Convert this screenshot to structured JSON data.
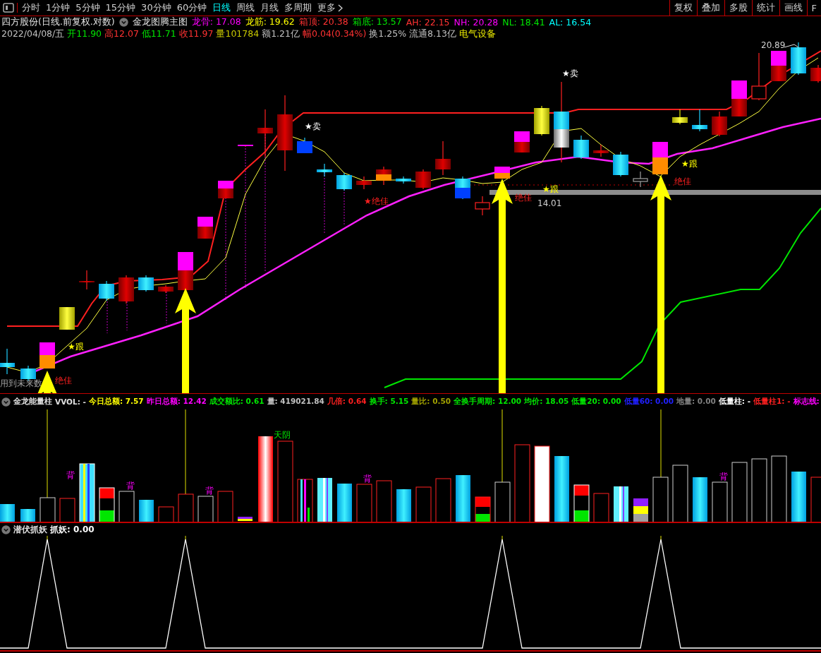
{
  "toolbar": {
    "periods": [
      {
        "label": "分时",
        "selected": false
      },
      {
        "label": "1分钟",
        "selected": false
      },
      {
        "label": "5分钟",
        "selected": false
      },
      {
        "label": "15分钟",
        "selected": false
      },
      {
        "label": "30分钟",
        "selected": false
      },
      {
        "label": "60分钟",
        "selected": false
      },
      {
        "label": "日线",
        "selected": true
      },
      {
        "label": "周线",
        "selected": false
      },
      {
        "label": "月线",
        "selected": false
      },
      {
        "label": "多周期",
        "selected": false
      }
    ],
    "more": "更多",
    "buttons": [
      "复权",
      "叠加",
      "多股",
      "统计",
      "画线",
      "F"
    ]
  },
  "main_header": {
    "title": "四方股份(日线.前复权.对数)",
    "indicator": "金龙图腾主图",
    "values": [
      {
        "text": "龙骨: 17.08",
        "color": "#ff00ff"
      },
      {
        "text": "龙筋: 19.62",
        "color": "#ffff00"
      },
      {
        "text": "箱顶: 20.38",
        "color": "#ff3232"
      },
      {
        "text": "箱底: 13.57",
        "color": "#00e600"
      },
      {
        "text": "AH: 22.15",
        "color": "#ff3232"
      },
      {
        "text": "NH: 20.28",
        "color": "#ff00ff"
      },
      {
        "text": "NL: 18.41",
        "color": "#00e600"
      },
      {
        "text": "AL: 16.54",
        "color": "#00ffff"
      }
    ]
  },
  "quote": {
    "date": "2022/04/08/五",
    "items": [
      {
        "text": "开11.90",
        "color": "#00e600"
      },
      {
        "text": "高12.07",
        "color": "#ff3232"
      },
      {
        "text": "低11.71",
        "color": "#00e600"
      },
      {
        "text": "收11.97",
        "color": "#ff3232"
      },
      {
        "text": "量101784",
        "color": "#c8c800"
      },
      {
        "text": "额1.21亿",
        "color": "#c0c0c0"
      },
      {
        "text": "幅0.04(0.34%)",
        "color": "#ff3232"
      },
      {
        "text": "换1.25%",
        "color": "#c0c0c0"
      },
      {
        "text": "流通8.13亿",
        "color": "#c0c0c0"
      },
      {
        "text": "电气设备",
        "color": "#e6e600"
      }
    ]
  },
  "main_labels": [
    {
      "text": "★卖",
      "kind": "sell"
    },
    {
      "text": "★卖",
      "kind": "sell"
    },
    {
      "text": "★跟",
      "kind": "follow"
    },
    {
      "text": "★跟",
      "kind": "follow"
    },
    {
      "text": "★跟",
      "kind": "follow"
    },
    {
      "text": "★绝佳",
      "kind": "best"
    },
    {
      "text": "绝佳",
      "kind": "best"
    },
    {
      "text": "绝佳",
      "kind": "best"
    },
    {
      "text": "绝佳",
      "kind": "best"
    },
    {
      "text": "14.01",
      "kind": "price"
    },
    {
      "text": "20.89",
      "kind": "price"
    },
    {
      "text": "用到未来数",
      "kind": "note"
    }
  ],
  "volume_header": {
    "indicator": "金龙能量柱",
    "values": [
      {
        "text": "VVOL: -",
        "color": "#e0e0e0"
      },
      {
        "text": "今日总额: 7.57",
        "color": "#ffff00"
      },
      {
        "text": "昨日总额: 12.42",
        "color": "#ff00ff"
      },
      {
        "text": "成交额比: 0.61",
        "color": "#00e600"
      },
      {
        "text": "量: 419021.84",
        "color": "#c0c0c0"
      },
      {
        "text": "几倍: 0.64",
        "color": "#ff2020"
      },
      {
        "text": "换手: 5.15",
        "color": "#00e600"
      },
      {
        "text": "量比: 0.50",
        "color": "#a0a000"
      },
      {
        "text": "全换手周期: 12.00",
        "color": "#00e600"
      },
      {
        "text": "均价: 18.05",
        "color": "#00e600"
      },
      {
        "text": "低量20: 0.00",
        "color": "#00e600"
      },
      {
        "text": "低量60: 0.00",
        "color": "#2020ff"
      },
      {
        "text": "地量: 0.00",
        "color": "#808080"
      },
      {
        "text": "低量柱: -",
        "color": "#ffffff"
      },
      {
        "text": "低量柱1: -",
        "color": "#ff2020"
      },
      {
        "text": "标志线:",
        "color": "#ff00ff"
      }
    ]
  },
  "volume_labels": [
    {
      "text": "背",
      "kind": "diverge"
    },
    {
      "text": "背",
      "kind": "diverge"
    },
    {
      "text": "背",
      "kind": "diverge"
    },
    {
      "text": "背",
      "kind": "diverge"
    },
    {
      "text": "背",
      "kind": "diverge"
    },
    {
      "text": "天阴",
      "kind": "sky"
    }
  ],
  "signal_header": {
    "indicator": "潜伏抓妖",
    "values": [
      {
        "text": "抓妖: 0.00",
        "color": "#ffffff"
      }
    ]
  }
}
